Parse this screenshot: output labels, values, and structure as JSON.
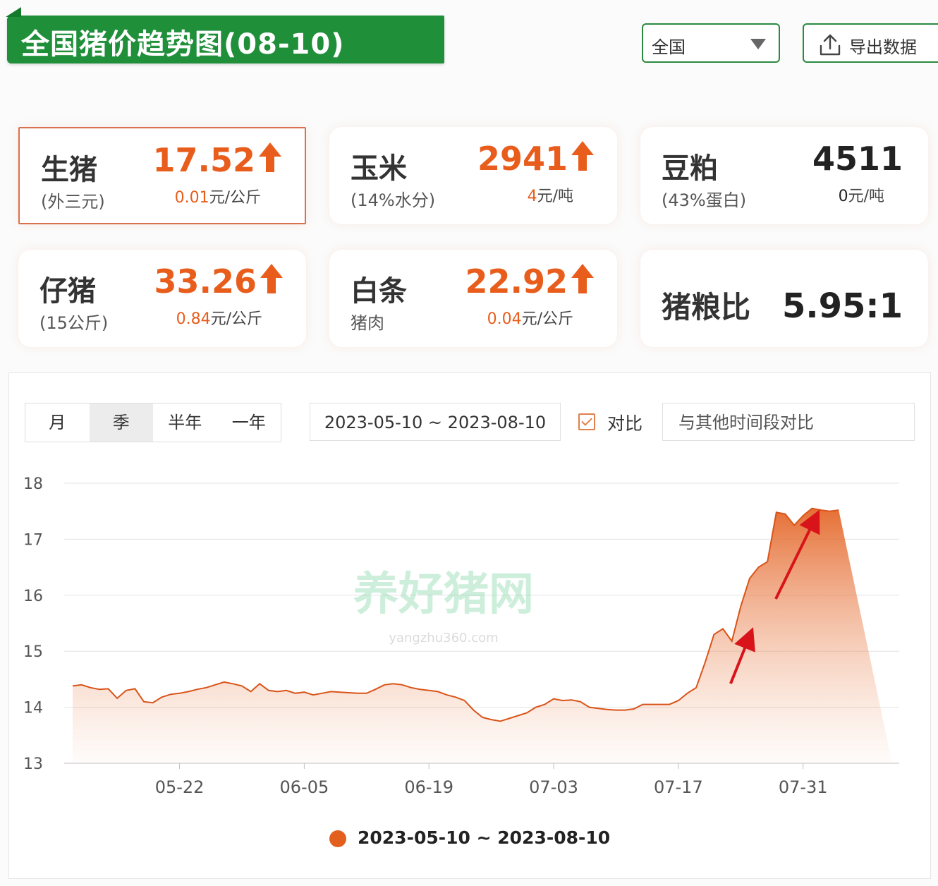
{
  "header": {
    "title": "全国猪价趋势图(08-10)",
    "region_value": "全国",
    "export_label": "导出数据"
  },
  "cards": [
    {
      "name": "生猪",
      "sub": "(外三元)",
      "price": "17.52",
      "change": "0.01",
      "unit": "元/公斤",
      "direction": "up"
    },
    {
      "name": "玉米",
      "sub": "(14%水分)",
      "price": "2941",
      "change": "4",
      "unit": "元/吨",
      "direction": "up"
    },
    {
      "name": "豆粕",
      "sub": "(43%蛋白)",
      "price": "4511",
      "change": "0",
      "unit": "元/吨",
      "direction": "flat"
    },
    {
      "name": "仔猪",
      "sub": "(15公斤)",
      "price": "33.26",
      "change": "0.84",
      "unit": "元/公斤",
      "direction": "up"
    },
    {
      "name": "白条",
      "sub": "猪肉",
      "price": "22.92",
      "change": "0.04",
      "unit": "元/公斤",
      "direction": "up"
    },
    {
      "name": "猪粮比",
      "value": "5.95:1"
    }
  ],
  "controls": {
    "tabs": [
      "月",
      "季",
      "半年",
      "一年"
    ],
    "selected_tab": "季",
    "date_range": "2023-05-10 ~ 2023-08-10",
    "compare_label": "对比",
    "compare_placeholder": "与其他时间段对比"
  },
  "watermark": {
    "text": "养好猪网",
    "url": "yangzhu360.com"
  },
  "colors": {
    "accent": "#e35f1e",
    "brand_green": "#1f8f3a"
  },
  "chart_data": {
    "type": "area",
    "x": [
      "05-10",
      "05-11",
      "05-12",
      "05-13",
      "05-14",
      "05-15",
      "05-16",
      "05-17",
      "05-18",
      "05-19",
      "05-20",
      "05-21",
      "05-22",
      "05-23",
      "05-24",
      "05-25",
      "05-26",
      "05-27",
      "05-28",
      "05-29",
      "05-30",
      "05-31",
      "06-01",
      "06-02",
      "06-03",
      "06-04",
      "06-05",
      "06-06",
      "06-07",
      "06-08",
      "06-09",
      "06-10",
      "06-11",
      "06-12",
      "06-13",
      "06-14",
      "06-15",
      "06-16",
      "06-17",
      "06-18",
      "06-19",
      "06-20",
      "06-21",
      "06-22",
      "06-23",
      "06-24",
      "06-25",
      "06-26",
      "06-27",
      "06-28",
      "06-29",
      "06-30",
      "07-01",
      "07-02",
      "07-03",
      "07-04",
      "07-05",
      "07-06",
      "07-07",
      "07-08",
      "07-09",
      "07-10",
      "07-11",
      "07-12",
      "07-13",
      "07-14",
      "07-15",
      "07-16",
      "07-17",
      "07-18",
      "07-19",
      "07-20",
      "07-21",
      "07-22",
      "07-23",
      "07-24",
      "07-25",
      "07-26",
      "07-27",
      "07-28",
      "07-29",
      "07-30",
      "07-31",
      "08-01",
      "08-02",
      "08-03",
      "08-04",
      "08-05",
      "08-06",
      "08-07",
      "08-08",
      "08-09",
      "08-10"
    ],
    "series": [
      {
        "name": "2023-05-10 ~ 2023-08-10",
        "values": [
          14.38,
          14.4,
          14.35,
          14.32,
          14.33,
          14.16,
          14.3,
          14.33,
          14.1,
          14.08,
          14.18,
          14.23,
          14.25,
          14.28,
          14.32,
          14.35,
          14.4,
          14.45,
          14.42,
          14.38,
          14.28,
          14.42,
          14.3,
          14.28,
          14.3,
          14.25,
          14.27,
          14.22,
          14.25,
          14.28,
          14.27,
          14.26,
          14.25,
          14.25,
          14.32,
          14.4,
          14.42,
          14.4,
          14.35,
          14.32,
          14.3,
          14.28,
          14.22,
          14.18,
          14.12,
          13.95,
          13.82,
          13.78,
          13.75,
          13.8,
          13.85,
          13.9,
          14.0,
          14.05,
          14.15,
          14.12,
          14.13,
          14.1,
          14.0,
          13.98,
          13.96,
          13.95,
          13.95,
          13.97,
          14.05,
          14.05,
          14.05,
          14.05,
          14.12,
          14.25,
          14.35,
          14.8,
          15.3,
          15.4,
          15.18,
          15.8,
          16.3,
          16.5,
          16.6,
          17.48,
          17.45,
          17.25,
          17.42,
          17.55,
          17.52,
          17.5,
          17.52
        ]
      }
    ],
    "ylim": [
      13,
      18
    ],
    "yticks": [
      13,
      14,
      15,
      16,
      17,
      18
    ],
    "xticks": [
      "05-22",
      "06-05",
      "06-19",
      "07-03",
      "07-17",
      "07-31"
    ],
    "legend": "bottom",
    "grid": true
  }
}
